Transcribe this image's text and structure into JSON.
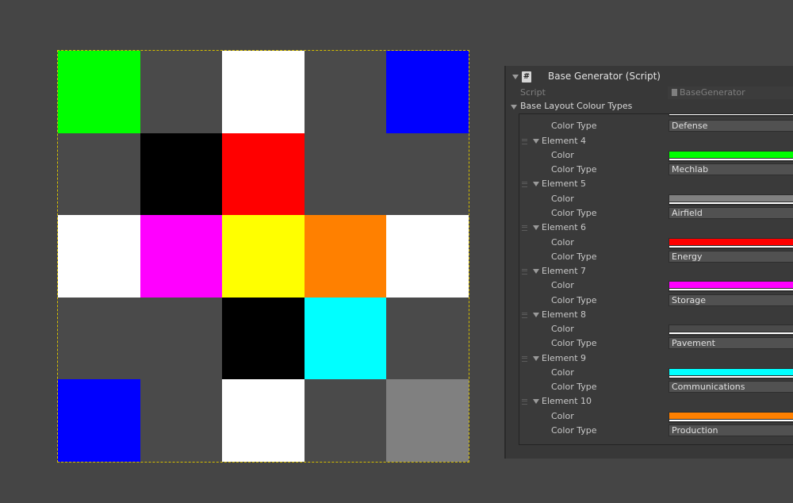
{
  "grid": {
    "rows": [
      [
        "#00ff00",
        "#4a4a4a",
        "#ffffff",
        "#4a4a4a",
        "#0000ff"
      ],
      [
        "#4a4a4a",
        "#000000",
        "#ff0000",
        "#4a4a4a",
        "#4a4a4a"
      ],
      [
        "#ffffff",
        "#ff00ff",
        "#ffff00",
        "#ff8000",
        "#ffffff"
      ],
      [
        "#4a4a4a",
        "#4a4a4a",
        "#000000",
        "#00ffff",
        "#4a4a4a"
      ],
      [
        "#0000ff",
        "#4a4a4a",
        "#ffffff",
        "#4a4a4a",
        "#808080"
      ]
    ]
  },
  "inspector": {
    "component_title": "Base Generator (Script)",
    "script_icon": "#",
    "script_label": "Script",
    "script_value": "BaseGenerator",
    "list_label": "Base Layout Colour Types",
    "color_label": "Color",
    "color_type_label": "Color Type",
    "partial_element": {
      "color": "#0000ff",
      "type": "Defense"
    },
    "elements": [
      {
        "label": "Element 4",
        "color": "#00ff00",
        "type": "Mechlab"
      },
      {
        "label": "Element 5",
        "color": "#808080",
        "type": "Airfield"
      },
      {
        "label": "Element 6",
        "color": "#ff0000",
        "type": "Energy"
      },
      {
        "label": "Element 7",
        "color": "#ff00ff",
        "type": "Storage"
      },
      {
        "label": "Element 8",
        "color": "#4a4a4a",
        "type": "Pavement"
      },
      {
        "label": "Element 9",
        "color": "#00ffff",
        "type": "Communications"
      },
      {
        "label": "Element 10",
        "color": "#ff8000",
        "type": "Production"
      }
    ]
  }
}
